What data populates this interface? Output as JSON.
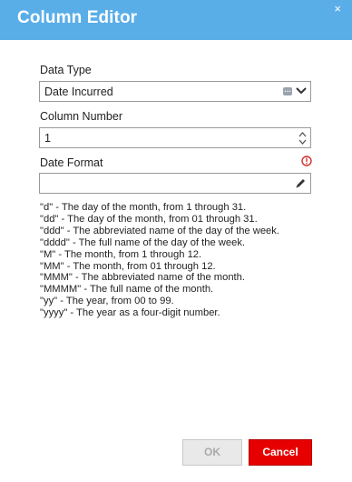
{
  "dialog": {
    "title": "Column Editor",
    "close_glyph": "×"
  },
  "data_type": {
    "label": "Data Type",
    "value": "Date Incurred"
  },
  "column_number": {
    "label": "Column Number",
    "value": "1"
  },
  "date_format": {
    "label": "Date Format",
    "value": ""
  },
  "help_lines": [
    "\"d\" - The day of the month, from 1 through 31.",
    "\"dd\" - The day of the month, from 01 through 31.",
    "\"ddd\" - The abbreviated name of the day of the week.",
    "\"dddd\" - The full name of the day of the week.",
    "\"M\" - The month, from 1 through 12.",
    "\"MM\" - The month, from 01 through 12.",
    "\"MMM\" - The abbreviated name of the month.",
    "\"MMMM\" - The full name of the month.",
    "\"yy\" - The year, from 00 to 99.",
    "\"yyyy\" - The year as a four-digit number."
  ],
  "buttons": {
    "ok": "OK",
    "cancel": "Cancel"
  },
  "colors": {
    "header": "#5aaee8",
    "cancel": "#e60000",
    "warning": "#d32f2f"
  },
  "icons": {
    "close": "close-icon",
    "lookup": "ellipsis-icon",
    "dropdown": "chevron-down-icon",
    "spin_up": "chevron-up-icon",
    "spin_down": "chevron-down-icon",
    "warning": "warning-icon",
    "edit": "pencil-icon"
  }
}
